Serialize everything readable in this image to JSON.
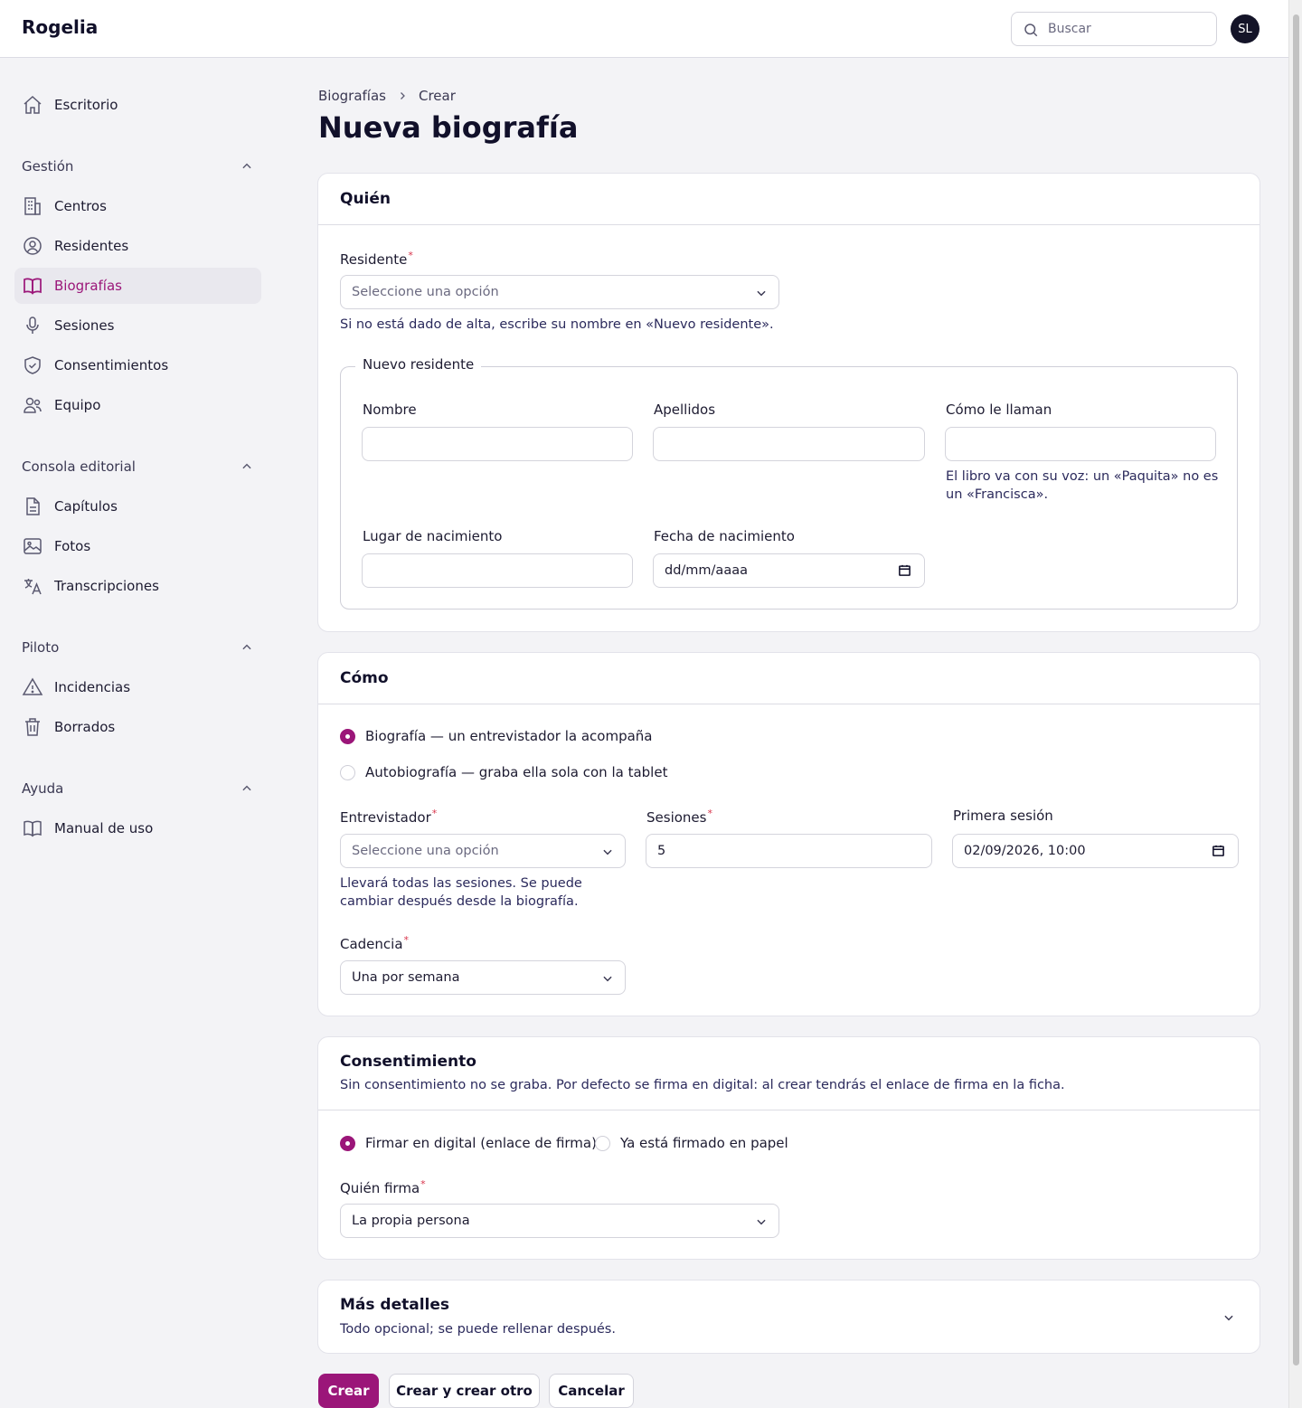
{
  "app": {
    "brand": "Rogelia",
    "avatar_initials": "SL"
  },
  "search": {
    "placeholder": "Buscar"
  },
  "sidebar": {
    "top_item": "Escritorio",
    "groups": [
      {
        "label": "Gestión",
        "items": [
          "Centros",
          "Residentes",
          "Biografías",
          "Sesiones",
          "Consentimientos",
          "Equipo"
        ]
      },
      {
        "label": "Consola editorial",
        "items": [
          "Capítulos",
          "Fotos",
          "Transcripciones"
        ]
      },
      {
        "label": "Piloto",
        "items": [
          "Incidencias",
          "Borrados"
        ]
      },
      {
        "label": "Ayuda",
        "items": [
          "Manual de uso"
        ]
      }
    ],
    "active_item": "Biografías"
  },
  "breadcrumb": {
    "parent": "Biografías",
    "current": "Crear"
  },
  "page_title": "Nueva biografía",
  "quien": {
    "title": "Quién",
    "residente_label": "Residente",
    "residente_placeholder": "Seleccione una opción",
    "residente_hint": "Si no está dado de alta, escribe su nombre en «Nuevo residente».",
    "nuevo_residente": {
      "legend": "Nuevo residente",
      "nombre_label": "Nombre",
      "apellidos_label": "Apellidos",
      "como_label": "Cómo le llaman",
      "como_hint_1": "El libro va con su voz: un «Paquita» no es",
      "como_hint_2": "un «Francisca».",
      "lugar_label": "Lugar de nacimiento",
      "fecha_label": "Fecha de nacimiento",
      "fecha_placeholder": "dd/mm/aaaa"
    }
  },
  "como": {
    "title": "Cómo",
    "radio_1": "Biografía — un entrevistador la acompaña",
    "radio_2": "Autobiografía — graba ella sola con la tablet",
    "selected": "radio_1",
    "entrevistador_label": "Entrevistador",
    "entrevistador_placeholder": "Seleccione una opción",
    "entrevistador_hint_1": "Llevará todas las sesiones. Se puede",
    "entrevistador_hint_2": "cambiar después desde la biografía.",
    "sesiones_label": "Sesiones",
    "sesiones_value": "5",
    "primera_label": "Primera sesión",
    "primera_value": "02/09/2026, 10:00",
    "cadencia_label": "Cadencia",
    "cadencia_value": "Una por semana"
  },
  "consentimiento": {
    "title": "Consentimiento",
    "description": "Sin consentimiento no se graba. Por defecto se firma en digital: al crear tendrás el enlace de firma en la ficha.",
    "radio_1": "Firmar en digital (enlace de firma)",
    "radio_2": "Ya está firmado en papel",
    "selected": "radio_1",
    "quien_firma_label": "Quién firma",
    "quien_firma_value": "La propia persona"
  },
  "mas_detalles": {
    "title": "Más detalles",
    "description": "Todo opcional; se puede rellenar después."
  },
  "actions": {
    "create": "Crear",
    "create_another": "Crear y crear otro",
    "cancel": "Cancelar"
  },
  "colors": {
    "accent": "#9b1679",
    "required": "#d8344b",
    "text": "#1d1b31",
    "background": "#f3f3f6"
  }
}
